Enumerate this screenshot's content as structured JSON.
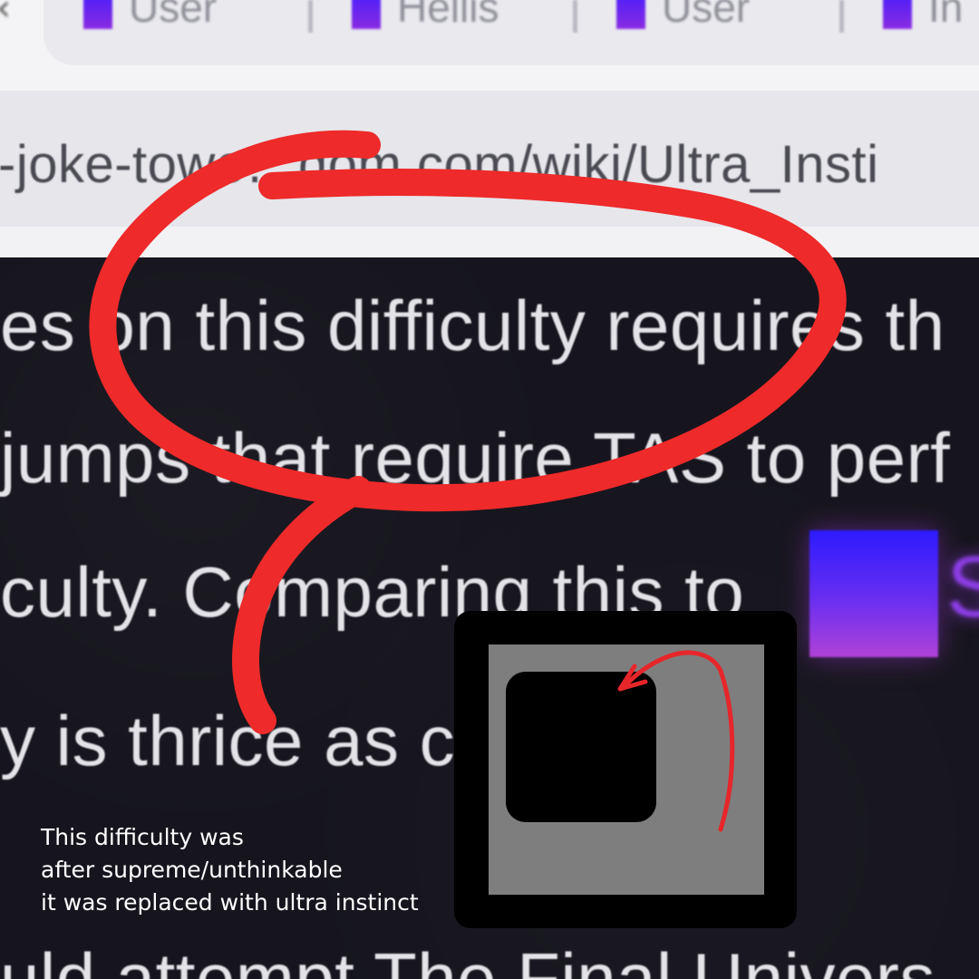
{
  "browser": {
    "tabs": [
      {
        "label": "User",
        "icon": "difficulty-favicon"
      },
      {
        "label": "Hellis",
        "icon": "difficulty-favicon"
      },
      {
        "label": "User",
        "icon": "difficulty-favicon"
      },
      {
        "label": "In",
        "icon": "difficulty-favicon"
      }
    ],
    "url": "-joke-towe…dom.com/wiki/Ultra_Insti"
  },
  "article": {
    "lines": [
      "es on this difficulty requires th",
      "jumps that require TAS to perf",
      "culty. Comparing this to",
      "y is thrice as c              g in ter",
      "uld attempt The Final Univers"
    ],
    "inline_badge_letter": "S"
  },
  "caption": {
    "line1": "This difficulty was",
    "line2": "after supreme/unthinkable",
    "line3": "it was replaced with ultra instinct"
  },
  "colors": {
    "scribble": "#ee2a2a",
    "icon_frame": "#000000",
    "icon_fill": "#7e7e7e",
    "page_bg": "#16151d"
  }
}
